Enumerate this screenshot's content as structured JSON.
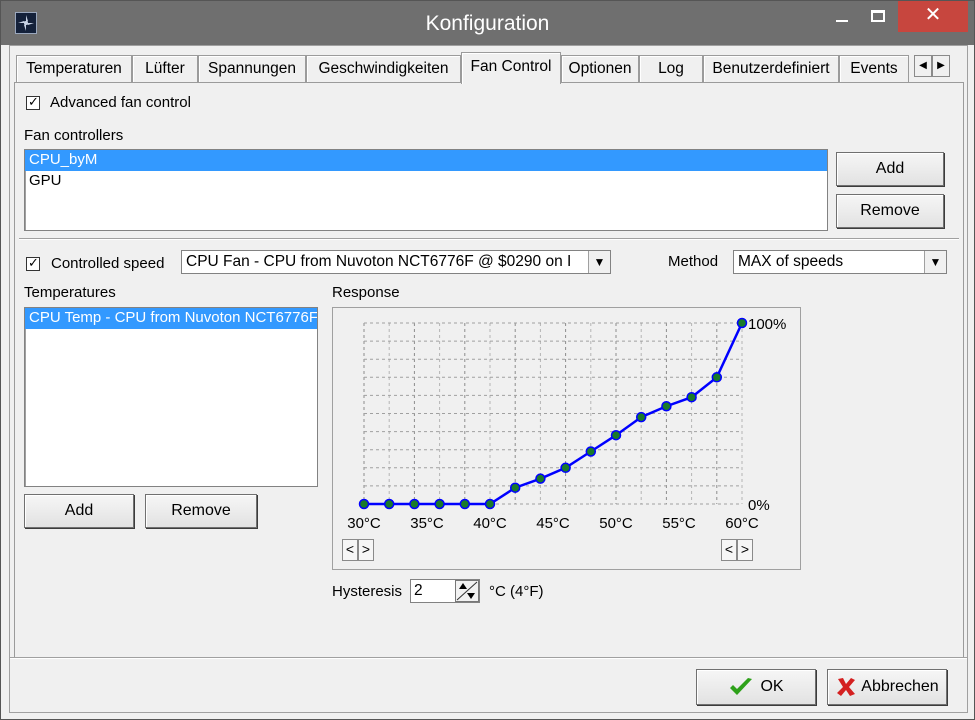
{
  "window": {
    "title": "Konfiguration",
    "min_glyph": "—",
    "close_glyph": "✕"
  },
  "tabs": [
    {
      "label": "Temperaturen"
    },
    {
      "label": "Lüfter"
    },
    {
      "label": "Spannungen"
    },
    {
      "label": "Geschwindigkeiten"
    },
    {
      "label": "Fan Control",
      "active": true
    },
    {
      "label": "Optionen"
    },
    {
      "label": "Log"
    },
    {
      "label": "Benutzerdefiniert"
    },
    {
      "label": "Events"
    }
  ],
  "tab_scroll": {
    "left": "◀",
    "right": "▶"
  },
  "advanced": {
    "label": "Advanced fan control",
    "checked": true,
    "check_glyph": "✓"
  },
  "fan_controllers": {
    "label": "Fan controllers",
    "items": [
      {
        "label": "CPU_byM",
        "selected": true
      },
      {
        "label": "GPU",
        "selected": false
      }
    ],
    "add_label": "Add",
    "remove_label": "Remove"
  },
  "controlled_speed": {
    "label": "Controlled speed",
    "checked": true,
    "check_glyph": "✓",
    "value": "CPU Fan - CPU from Nuvoton NCT6776F @ $0290 on I",
    "arrow": "▼"
  },
  "method": {
    "label": "Method",
    "value": "MAX of speeds",
    "arrow": "▼"
  },
  "temperatures": {
    "label": "Temperatures",
    "items": [
      {
        "label": "CPU Temp - CPU from Nuvoton NCT6776F",
        "selected": true
      }
    ],
    "add_label": "Add",
    "remove_label": "Remove"
  },
  "response": {
    "label": "Response",
    "nav_left": "<",
    "nav_right": ">"
  },
  "hysteresis": {
    "label": "Hysteresis",
    "value": "2",
    "unit": "°C (4°F)"
  },
  "footer": {
    "ok_label": "OK",
    "cancel_label": "Abbrechen",
    "colors": {
      "ok_check": "#2ea11a",
      "cancel_x": "#d42020"
    }
  },
  "chart_data": {
    "type": "line",
    "title": "",
    "xlabel": "",
    "ylabel": "",
    "x_ticks": [
      "30°C",
      "35°C",
      "40°C",
      "45°C",
      "50°C",
      "55°C",
      "60°C"
    ],
    "y_ticks": [
      "0%",
      "100%"
    ],
    "xlim": [
      30,
      60
    ],
    "ylim": [
      0,
      100
    ],
    "grid": true,
    "series": [
      {
        "x": [
          30,
          32,
          34,
          36,
          38,
          40,
          42,
          44,
          46,
          48,
          50,
          52,
          54,
          56,
          58,
          60
        ],
        "y": [
          0,
          0,
          0,
          0,
          0,
          0,
          9,
          14,
          20,
          29,
          38,
          48,
          54,
          59,
          70,
          100
        ],
        "line_color": "#0000ff",
        "marker_color": "#1a7a2a"
      }
    ]
  }
}
